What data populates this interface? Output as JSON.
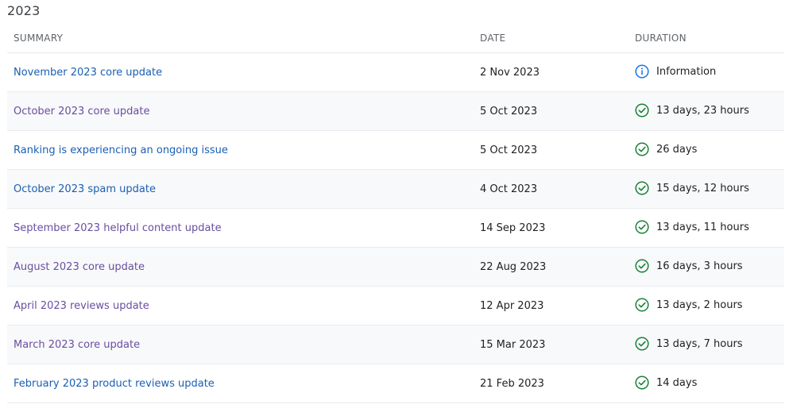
{
  "year_heading": "2023",
  "columns": {
    "summary": "SUMMARY",
    "date": "DATE",
    "duration": "DURATION"
  },
  "colors": {
    "link": "#1a5fb4",
    "visited_link": "#6a4ea0",
    "success": "#188038",
    "info": "#1a73e8"
  },
  "rows": [
    {
      "summary": "November 2023 core update",
      "date": "2 Nov 2023",
      "duration": "Information",
      "status_icon": "info-icon",
      "visited": false
    },
    {
      "summary": "October 2023 core update",
      "date": "5 Oct 2023",
      "duration": "13 days, 23 hours",
      "status_icon": "check-circle-icon",
      "visited": true
    },
    {
      "summary": "Ranking is experiencing an ongoing issue",
      "date": "5 Oct 2023",
      "duration": "26 days",
      "status_icon": "check-circle-icon",
      "visited": false
    },
    {
      "summary": "October 2023 spam update",
      "date": "4 Oct 2023",
      "duration": "15 days, 12 hours",
      "status_icon": "check-circle-icon",
      "visited": false
    },
    {
      "summary": "September 2023 helpful content update",
      "date": "14 Sep 2023",
      "duration": "13 days, 11 hours",
      "status_icon": "check-circle-icon",
      "visited": true
    },
    {
      "summary": "August 2023 core update",
      "date": "22 Aug 2023",
      "duration": "16 days, 3 hours",
      "status_icon": "check-circle-icon",
      "visited": true
    },
    {
      "summary": "April 2023 reviews update",
      "date": "12 Apr 2023",
      "duration": "13 days, 2 hours",
      "status_icon": "check-circle-icon",
      "visited": true
    },
    {
      "summary": "March 2023 core update",
      "date": "15 Mar 2023",
      "duration": "13 days, 7 hours",
      "status_icon": "check-circle-icon",
      "visited": true
    },
    {
      "summary": "February 2023 product reviews update",
      "date": "21 Feb 2023",
      "duration": "14 days",
      "status_icon": "check-circle-icon",
      "visited": false
    }
  ]
}
